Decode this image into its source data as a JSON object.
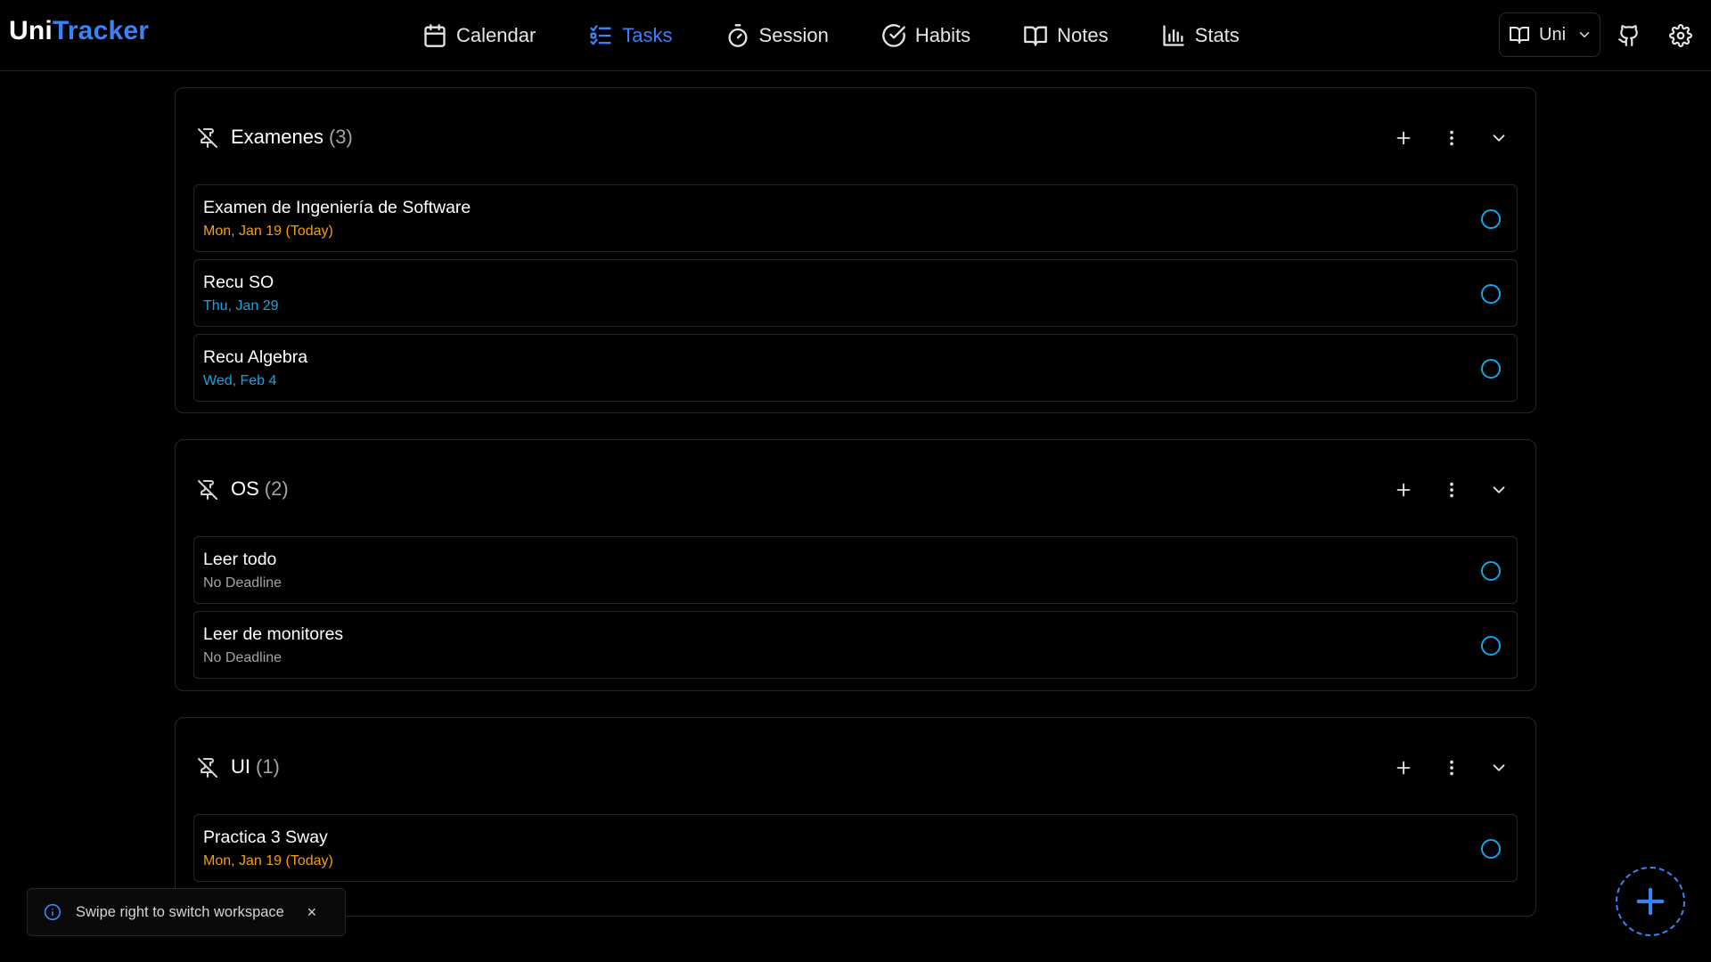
{
  "app": {
    "brand_part1": "Uni",
    "brand_part2": "Tracker"
  },
  "nav": {
    "items": [
      {
        "label": "Calendar",
        "icon": "calendar-icon"
      },
      {
        "label": "Tasks",
        "icon": "tasks-icon",
        "active": true
      },
      {
        "label": "Session",
        "icon": "timer-icon"
      },
      {
        "label": "Habits",
        "icon": "check-circle-icon"
      },
      {
        "label": "Notes",
        "icon": "book-icon"
      },
      {
        "label": "Stats",
        "icon": "bar-chart-icon"
      }
    ]
  },
  "workspace": {
    "label": "Uni",
    "icon": "book-icon"
  },
  "colors": {
    "accent": "#3b82f6",
    "today": "#f59e0b",
    "future": "#0ea5e9",
    "muted": "#a3a3a3"
  },
  "groups": [
    {
      "name": "Examenes",
      "count": "(3)",
      "tasks": [
        {
          "title": "Examen de Ingeniería de Software",
          "date": "Mon, Jan 19 (Today)"
        },
        {
          "title": "Recu SO",
          "date": "Thu, Jan 29"
        },
        {
          "title": "Recu Algebra",
          "date": "Wed, Feb 4"
        }
      ]
    },
    {
      "name": "OS",
      "count": "(2)",
      "tasks": [
        {
          "title": "Leer todo",
          "date": "No Deadline"
        },
        {
          "title": "Leer de monitores",
          "date": "No Deadline"
        }
      ]
    },
    {
      "name": "UI",
      "count": "(1)",
      "tasks": [
        {
          "title": "Practica 3 Sway",
          "date": "Mon, Jan 19 (Today)"
        }
      ]
    }
  ],
  "toast": {
    "message": "Swipe right to switch workspace",
    "close": "×"
  }
}
